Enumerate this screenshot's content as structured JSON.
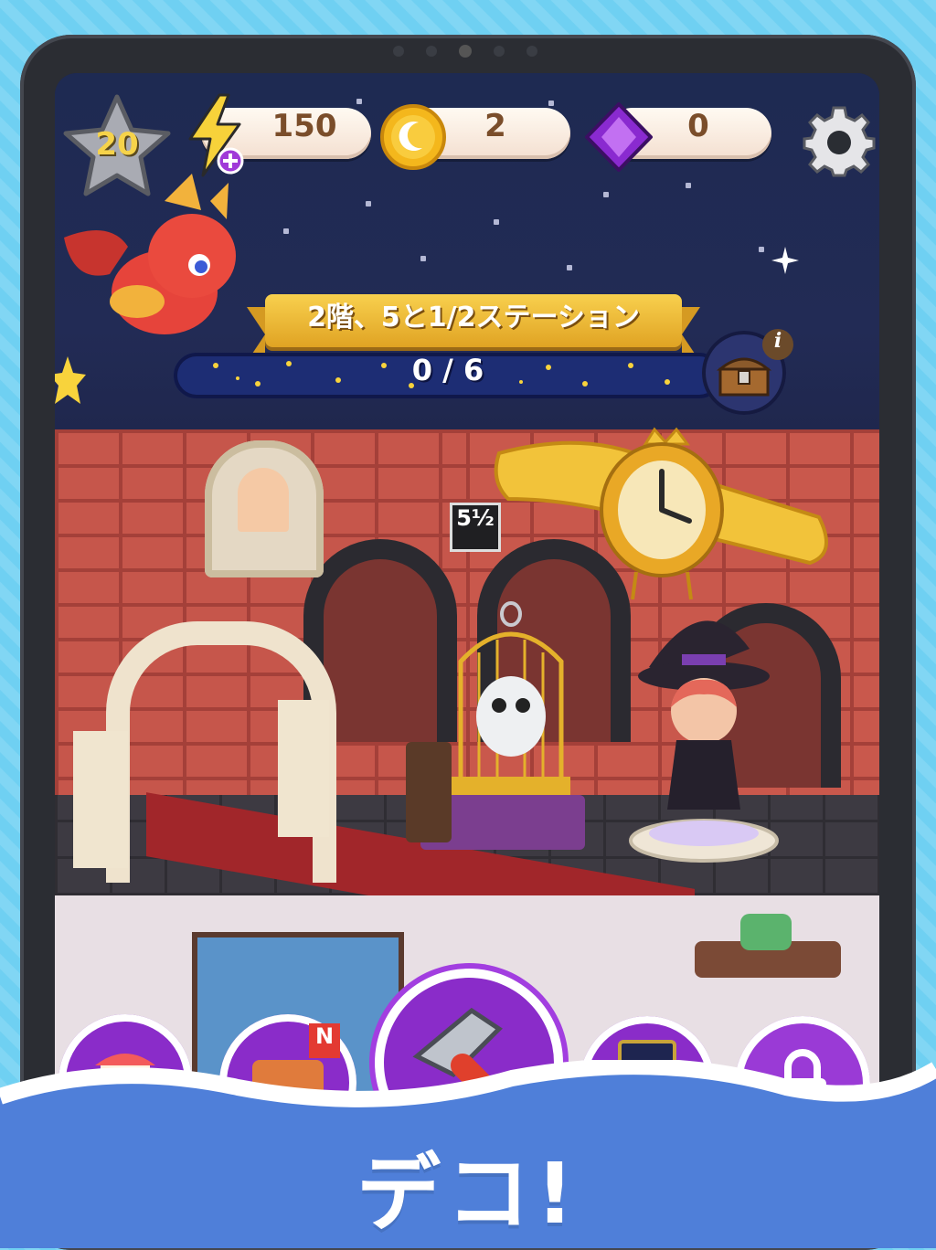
{
  "hud": {
    "level": "20",
    "energy": "150",
    "coins": "2",
    "gems": "0"
  },
  "station": {
    "title": "2階、5と1/2ステーション",
    "progress_text": "0 / 6",
    "progress_fraction": 0
  },
  "room": {
    "platform_sign": "5½"
  },
  "bottom_bar": {
    "new_badge": "N"
  },
  "caption": "デコ!",
  "colors": {
    "background": "#6fd0f2",
    "banner": "#f2bf3c",
    "progress_bar": "#1d2d74",
    "button_purple": "#8a2cc9",
    "wave": "#4f7fd9"
  },
  "icons": [
    "star-level-icon",
    "energy-bolt-icon",
    "moon-coin-icon",
    "purple-gem-icon",
    "gear-icon",
    "treasure-chest-icon",
    "info-icon",
    "shop-icon",
    "cards-icon",
    "hammer-icon",
    "tarot-card-icon",
    "lock-icon"
  ]
}
